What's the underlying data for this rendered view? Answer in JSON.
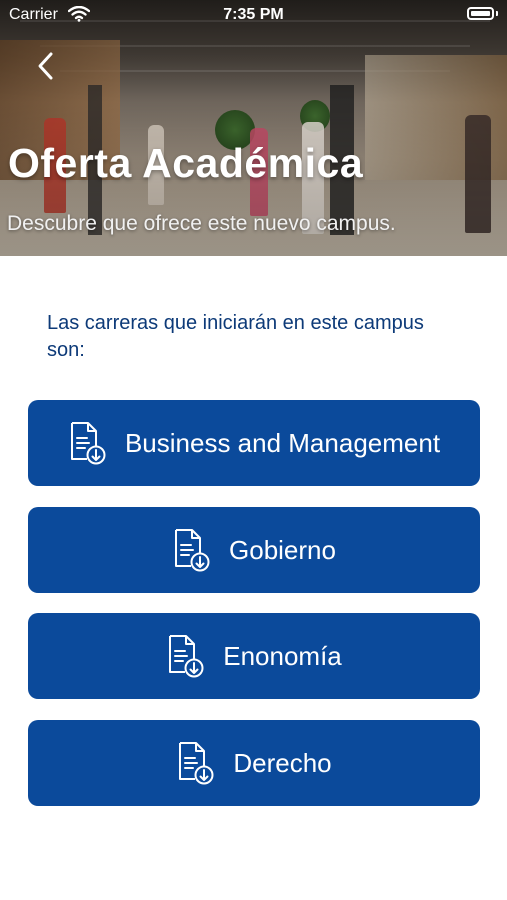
{
  "status_bar": {
    "carrier": "Carrier",
    "time": "7:35 PM"
  },
  "header": {
    "title": "Oferta Académica",
    "subtitle": "Descubre que ofrece este nuevo campus."
  },
  "intro_text": "Las carreras que iniciarán en este campus son:",
  "careers": [
    {
      "label": "Business and Management",
      "icon": "document-download-icon"
    },
    {
      "label": "Gobierno",
      "icon": "document-download-icon"
    },
    {
      "label": "Enonomía",
      "icon": "document-download-icon"
    },
    {
      "label": "Derecho",
      "icon": "document-download-icon"
    }
  ],
  "colors": {
    "primary": "#0b4a9b",
    "intro_text": "#0d3a78",
    "background": "#ffffff"
  }
}
